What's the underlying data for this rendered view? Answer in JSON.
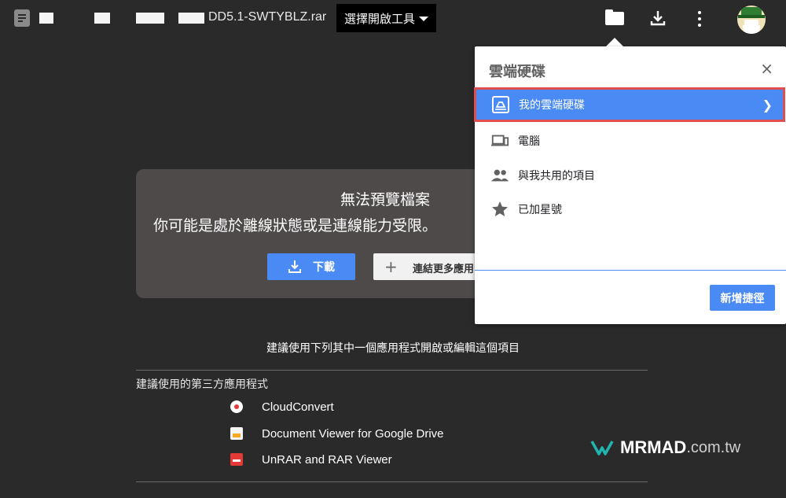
{
  "header": {
    "file_name": "DD5.1-SWTYBLZ.rar",
    "open_with_label": "選擇開啟工具"
  },
  "preview": {
    "title": "無法預覽檔案",
    "subtitle": "你可能是處於離線狀態或是連線能力受限。",
    "download_label": "下載",
    "connect_label": "連結更多應用"
  },
  "suggestions": {
    "heading": "建議使用下列其中一個應用程式開啟或編輯這個項目",
    "third_party_title": "建議使用的第三方應用程式",
    "apps": [
      {
        "name": "CloudConvert",
        "icon": "cloudconvert-icon"
      },
      {
        "name": "Document Viewer for Google Drive",
        "icon": "document-viewer-icon"
      },
      {
        "name": "UnRAR and RAR Viewer",
        "icon": "rar-viewer-icon"
      }
    ]
  },
  "drive_popup": {
    "title": "雲端硬碟",
    "close_symbol": "×",
    "items": [
      {
        "label": "我的雲端硬碟",
        "icon": "drive-icon",
        "selected": true
      },
      {
        "label": "電腦",
        "icon": "computer-icon",
        "selected": false
      },
      {
        "label": "與我共用的項目",
        "icon": "shared-people-icon",
        "selected": false
      },
      {
        "label": "已加星號",
        "icon": "star-icon",
        "selected": false
      }
    ],
    "add_shortcut_label": "新增捷徑"
  },
  "watermark": {
    "brand": "MRMAD",
    "tld": ".com.tw"
  },
  "colors": {
    "background": "#2b2a2a",
    "accent_blue": "#4a8af4",
    "highlight_red": "#e04f4f",
    "card": "#4e4a4a",
    "watermark_teal": "#1fb5b0"
  }
}
